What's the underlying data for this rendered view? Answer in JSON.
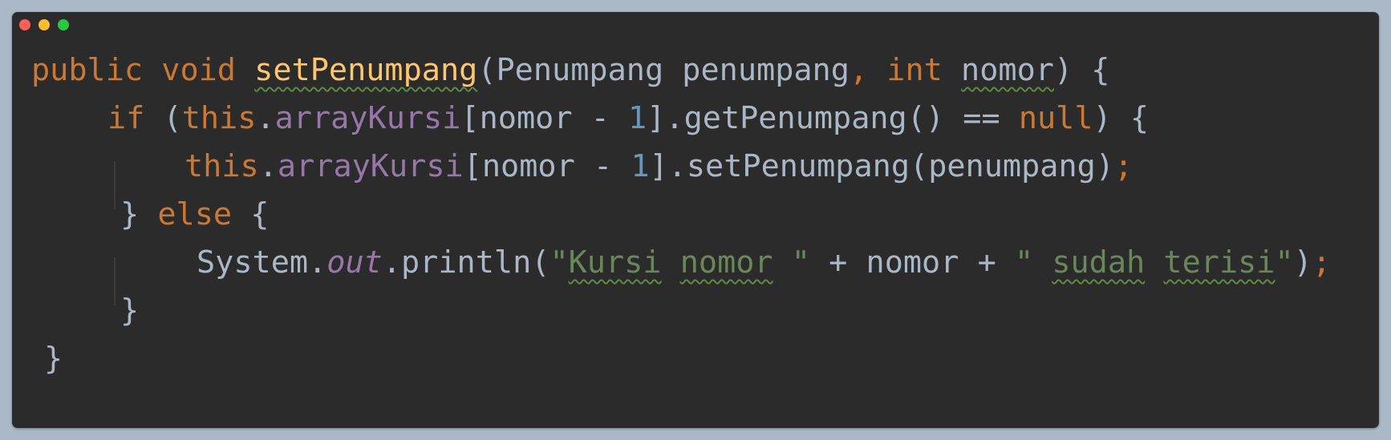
{
  "window": {
    "traffic_lights": {
      "close_color": "#ff5f57",
      "minimize_color": "#febc2e",
      "zoom_color": "#28c840"
    }
  },
  "code": {
    "language": "java",
    "lines": [
      [
        {
          "t": "public",
          "c": "kw"
        },
        {
          "t": " "
        },
        {
          "t": "void",
          "c": "kw"
        },
        {
          "t": " "
        },
        {
          "t": "setPenumpang",
          "c": "fn",
          "squiggle": true
        },
        {
          "t": "(Penumpang penumpang"
        },
        {
          "t": ",",
          "c": "kw"
        },
        {
          "t": " "
        },
        {
          "t": "int",
          "c": "kw"
        },
        {
          "t": " "
        },
        {
          "t": "nomor",
          "squiggle": true
        },
        {
          "t": ") {"
        }
      ],
      [
        {
          "t": "if",
          "c": "kw"
        },
        {
          "t": " ("
        },
        {
          "t": "this",
          "c": "kw"
        },
        {
          "t": "."
        },
        {
          "t": "arrayKursi",
          "c": "field"
        },
        {
          "t": "[nomor - "
        },
        {
          "t": "1",
          "c": "num"
        },
        {
          "t": "].getPenumpang() == "
        },
        {
          "t": "null",
          "c": "kw"
        },
        {
          "t": ") {"
        }
      ],
      [
        {
          "t": "this",
          "c": "kw"
        },
        {
          "t": "."
        },
        {
          "t": "arrayKursi",
          "c": "field"
        },
        {
          "t": "[nomor - "
        },
        {
          "t": "1",
          "c": "num"
        },
        {
          "t": "].setPenumpang(penumpang)"
        },
        {
          "t": ";",
          "c": "kw"
        }
      ],
      [
        {
          "t": "} "
        },
        {
          "t": "else",
          "c": "kw"
        },
        {
          "t": " {"
        }
      ],
      [
        {
          "t": "System."
        },
        {
          "t": "out",
          "c": "static-field"
        },
        {
          "t": ".println("
        },
        {
          "t": "\"",
          "c": "str"
        },
        {
          "t": "Kursi",
          "c": "str",
          "squiggle": true
        },
        {
          "t": " ",
          "c": "str"
        },
        {
          "t": "nomor",
          "c": "str",
          "squiggle": true
        },
        {
          "t": " \"",
          "c": "str"
        },
        {
          "t": " + nomor + "
        },
        {
          "t": "\" ",
          "c": "str"
        },
        {
          "t": "sudah",
          "c": "str",
          "squiggle": true
        },
        {
          "t": " ",
          "c": "str"
        },
        {
          "t": "terisi",
          "c": "str",
          "squiggle": true
        },
        {
          "t": "\"",
          "c": "str"
        },
        {
          "t": ")"
        },
        {
          "t": ";",
          "c": "kw"
        }
      ],
      [
        {
          "t": "}"
        }
      ],
      [
        {
          "t": "}"
        }
      ]
    ]
  }
}
